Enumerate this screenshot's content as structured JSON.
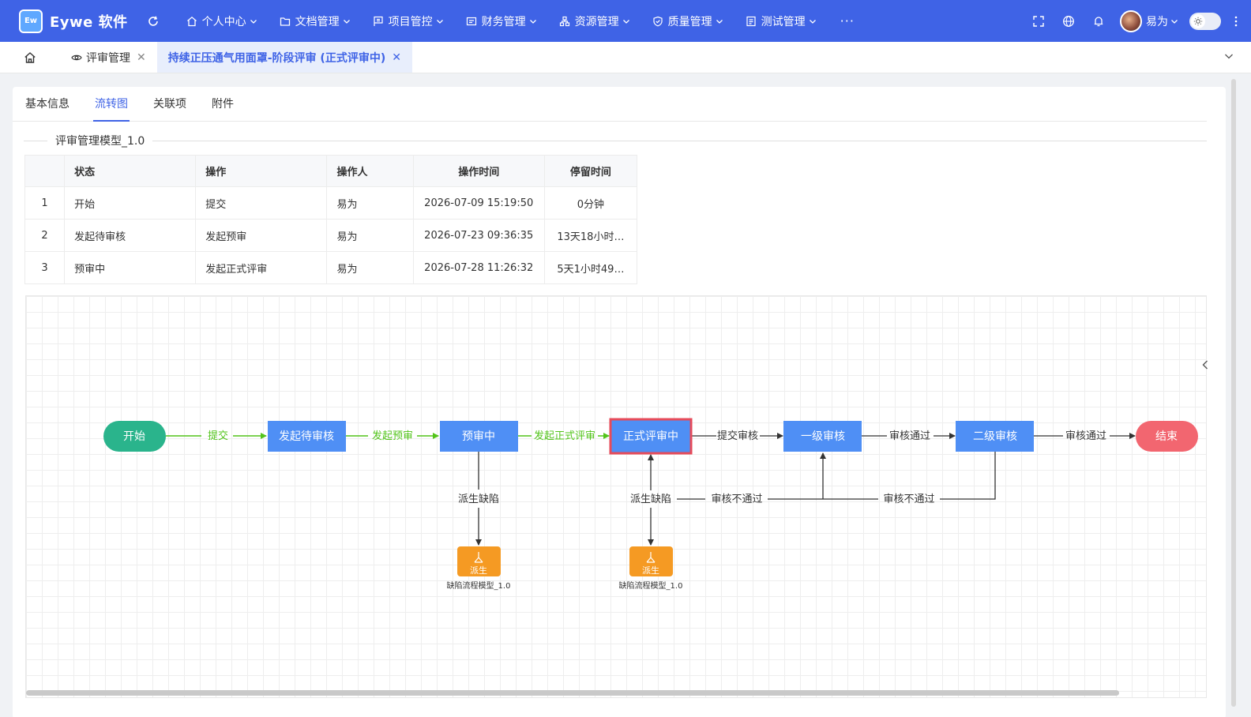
{
  "app": {
    "logo_mark": "Ew",
    "name": "Eywe 软件"
  },
  "nav": {
    "items": [
      {
        "label": "个人中心",
        "icon": "home-icon"
      },
      {
        "label": "文档管理",
        "icon": "folder-icon"
      },
      {
        "label": "项目管控",
        "icon": "flag-icon"
      },
      {
        "label": "财务管理",
        "icon": "finance-icon"
      },
      {
        "label": "资源管理",
        "icon": "resource-icon"
      },
      {
        "label": "质量管理",
        "icon": "shield-icon"
      },
      {
        "label": "测试管理",
        "icon": "test-icon"
      }
    ],
    "more": "···"
  },
  "user": {
    "name": "易为"
  },
  "tabs": [
    {
      "label": "评审管理",
      "icon": "eye-icon"
    },
    {
      "label": "持续正压通气用面罩-阶段评审 (正式评审中)",
      "active": true
    }
  ],
  "subtabs": [
    "基本信息",
    "流转图",
    "关联项",
    "附件"
  ],
  "active_subtab": 1,
  "model_title": "评审管理模型_1.0",
  "table": {
    "headers": [
      "",
      "状态",
      "操作",
      "操作人",
      "操作时间",
      "停留时间"
    ],
    "rows": [
      [
        "1",
        "开始",
        "提交",
        "易为",
        "2026-07-09 15:19:50",
        "0分钟"
      ],
      [
        "2",
        "发起待审核",
        "发起预审",
        "易为",
        "2026-07-23 09:36:35",
        "13天18小时…"
      ],
      [
        "3",
        "预审中",
        "发起正式评审",
        "易为",
        "2026-07-28 11:26:32",
        "5天1小时49…"
      ]
    ]
  },
  "flow": {
    "colors": {
      "start": "#2ab48c",
      "end": "#f26670",
      "node": "#4f8ff5",
      "current_border": "#e64b5a",
      "done_edge": "#52c41a",
      "edge": "#333333",
      "derive": "#f59a23"
    },
    "nodes": {
      "start": "开始",
      "pending": "发起待审核",
      "prereview": "预审中",
      "formal": "正式评审中",
      "level1": "一级审核",
      "level2": "二级审核",
      "end": "结束"
    },
    "edges": {
      "submit": "提交",
      "start_prereview": "发起预审",
      "start_formal": "发起正式评审",
      "submit_audit": "提交审核",
      "pass1": "审核通过",
      "pass2": "审核通过",
      "derive1": "派生缺陷",
      "derive2": "派生缺陷",
      "reject1": "审核不通过",
      "reject2": "审核不通过"
    },
    "derive_nodes": [
      {
        "label": "派生",
        "caption": "缺陷流程模型_1.0"
      },
      {
        "label": "派生",
        "caption": "缺陷流程模型_1.0"
      }
    ]
  }
}
